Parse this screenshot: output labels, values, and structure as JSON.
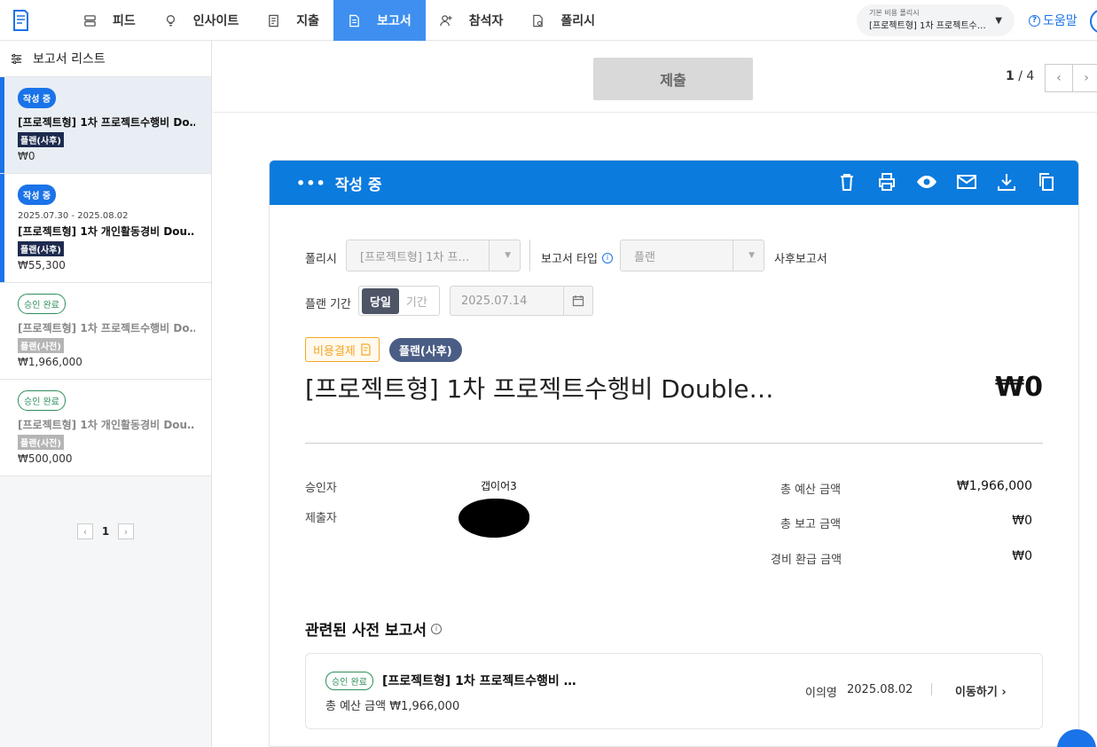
{
  "nav": {
    "items": [
      {
        "label": "피드",
        "icon": "feed-icon"
      },
      {
        "label": "인사이트",
        "icon": "lightbulb-icon"
      },
      {
        "label": "지출",
        "icon": "receipt-icon"
      },
      {
        "label": "보고서",
        "icon": "report-icon",
        "active": true
      },
      {
        "label": "참석자",
        "icon": "add-person-icon"
      },
      {
        "label": "폴리시",
        "icon": "policy-icon"
      }
    ],
    "policy_caption": "기본 비용 폴리시",
    "policy_value": "[프로젝트형] 1차 프로젝트수…",
    "help_label": "도움말"
  },
  "sidebar": {
    "title": "보고서 리스트",
    "cards": [
      {
        "status": "작성 중",
        "date": "",
        "title": "[프로젝트형] 1차 프로젝트수행비 Do…",
        "plan": "플랜(사후)",
        "amount": "₩0"
      },
      {
        "status": "작성 중",
        "date": "2025.07.30 - 2025.08.02",
        "title": "[프로젝트형] 1차 개인활동경비 Dou…",
        "plan": "플랜(사후)",
        "amount": "₩55,300"
      },
      {
        "status": "승인 완료",
        "date": "",
        "title": "[프로젝트형] 1차 프로젝트수행비 Do…",
        "plan": "플랜(사전)",
        "amount": "₩1,966,000"
      },
      {
        "status": "승인 완료",
        "date": "",
        "title": "[프로젝트형] 1차 개인활동경비 Dou…",
        "plan": "플랜(사전)",
        "amount": "₩500,000"
      }
    ],
    "page": "1"
  },
  "actionbar": {
    "submit_label": "제출",
    "current_page": "1",
    "total_pages": "/ 4"
  },
  "report": {
    "status": "작성 중",
    "policy_label": "폴리시",
    "policy_value": "[프로젝트형] 1차 프…",
    "type_label": "보고서 타입",
    "type_value": "플랜",
    "type_suffix": "사후보고서",
    "period_label": "플랜 기간",
    "period_on": "당일",
    "period_off": "기간",
    "date_value": "2025.07.14",
    "tag_cost": "비용결제",
    "tag_plan": "플랜(사후)",
    "title": "[프로젝트형] 1차 프로젝트수행비 Double…",
    "amount": "₩0",
    "approver_label": "승인자",
    "approver_value": "갭이어3",
    "submitter_label": "제출자",
    "budget_label": "총 예산 금액",
    "budget_value": "₩1,966,000",
    "reported_label": "총 보고 금액",
    "reported_value": "₩0",
    "refund_label": "경비 환급 금액",
    "refund_value": "₩0"
  },
  "related": {
    "title": "관련된 사전 보고서",
    "badge": "승인 완료",
    "item_title": "[프로젝트형] 1차 프로젝트수행비 …",
    "budget": "총 예산 금액 ₩1,966,000",
    "person": "이의영",
    "date": "2025.08.02",
    "move_label": "이동하기"
  },
  "colors": {
    "accent": "#0b7bdd",
    "nav_active": "#3e8ff0",
    "approved": "#2e8f5b",
    "cost_tag": "#f5a623"
  }
}
